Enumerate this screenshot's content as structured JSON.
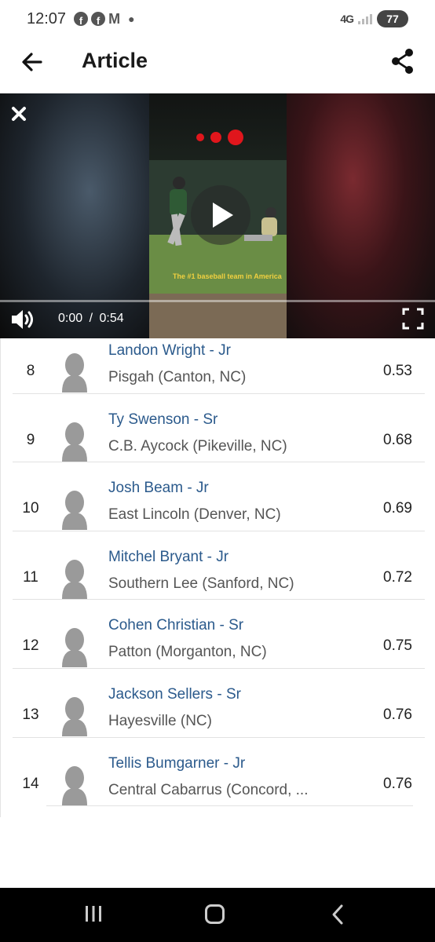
{
  "status_bar": {
    "time": "12:07",
    "network": "4G",
    "battery": "77",
    "icons": [
      "facebook-icon",
      "facebook-icon",
      "gmail-icon",
      "dot-icon"
    ]
  },
  "app_bar": {
    "title": "Article",
    "back_icon": "arrow-left-icon",
    "share_icon": "share-icon"
  },
  "video": {
    "current_time": "0:00",
    "separator": "/",
    "duration": "0:54",
    "progress": 0,
    "caption": "The #1 baseball team in America",
    "close_icon": "close-icon",
    "play_icon": "play-icon",
    "volume_icon": "volume-icon",
    "fullscreen_icon": "fullscreen-icon"
  },
  "rankings": [
    {
      "rank": "8",
      "name": "Landon Wright - Jr",
      "school": "Pisgah (Canton, NC)",
      "time": "0.53"
    },
    {
      "rank": "9",
      "name": "Ty Swenson - Sr",
      "school": "C.B. Aycock (Pikeville, NC)",
      "time": "0.68"
    },
    {
      "rank": "10",
      "name": "Josh Beam - Jr",
      "school": "East Lincoln (Denver, NC)",
      "time": "0.69"
    },
    {
      "rank": "11",
      "name": "Mitchel Bryant - Jr",
      "school": "Southern Lee (Sanford, NC)",
      "time": "0.72"
    },
    {
      "rank": "12",
      "name": "Cohen Christian - Sr",
      "school": "Patton (Morganton, NC)",
      "time": "0.75"
    },
    {
      "rank": "13",
      "name": "Jackson Sellers - Sr",
      "school": "Hayesville (NC)",
      "time": "0.76"
    },
    {
      "rank": "14",
      "name": "Tellis Bumgarner - Jr",
      "school": "Central Cabarrus (Concord, ...",
      "time": "0.76"
    }
  ],
  "nav_bar": {
    "recents_icon": "recents-icon",
    "home_icon": "home-icon",
    "back_icon": "nav-back-icon"
  }
}
